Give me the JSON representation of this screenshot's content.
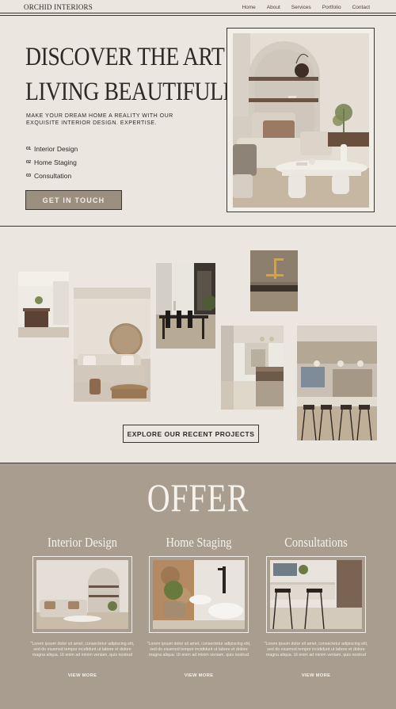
{
  "brand": {
    "logo": "ORCHID INTERIORS"
  },
  "nav": {
    "items": [
      "Home",
      "About",
      "Services",
      "Portfolio",
      "Contact"
    ]
  },
  "hero": {
    "title_line1": "DISCOVER THE ART OF",
    "title_line2": "LIVING BEAUTIFULLY.",
    "subtitle": "MAKE YOUR DREAM HOME A REALITY WITH OUR EXQUISITE INTERIOR DESIGN. EXPERTISE.",
    "services": [
      {
        "num": "01",
        "label": "Interior Design"
      },
      {
        "num": "02",
        "label": "Home Staging"
      },
      {
        "num": "03",
        "label": "Consultation"
      }
    ],
    "cta_label": "GET IN TOUCH"
  },
  "gallery": {
    "button_label": "EXPLORE OUR RECENT PROJECTS"
  },
  "offer": {
    "title": "OFFER",
    "cards": [
      {
        "title": "Interior Design",
        "text": "\"Lorem ipsum dolor sit amet, consectetur adipiscing elit, sed do eiusmod tempor incididunt ut labore et dolore magna aliqua. Ut enim ad minim veniam, quis nostrud",
        "link": "VIEW MORE"
      },
      {
        "title": "Home Staging",
        "text": "\"Lorem ipsum dolor sit amet, consectetur adipiscing elit, sed do eiusmod tempor incididunt ut labore et dolore magna aliqua. Ut enim ad minim veniam, quis nostrud",
        "link": "VIEW MORE"
      },
      {
        "title": "Consultations",
        "text": "\"Lorem ipsum dolor sit amet, consectetur adipiscing elit, sed do eiusmod tempor incididunt ut labore et dolore magna aliqua. Ut enim ad minim veniam, quis nostrud",
        "link": "VIEW MORE"
      }
    ]
  },
  "colors": {
    "page_bg": "#ebe6df",
    "offer_bg": "#a89d8f",
    "ink": "#2d2925",
    "button_bg": "#9b8f80"
  }
}
